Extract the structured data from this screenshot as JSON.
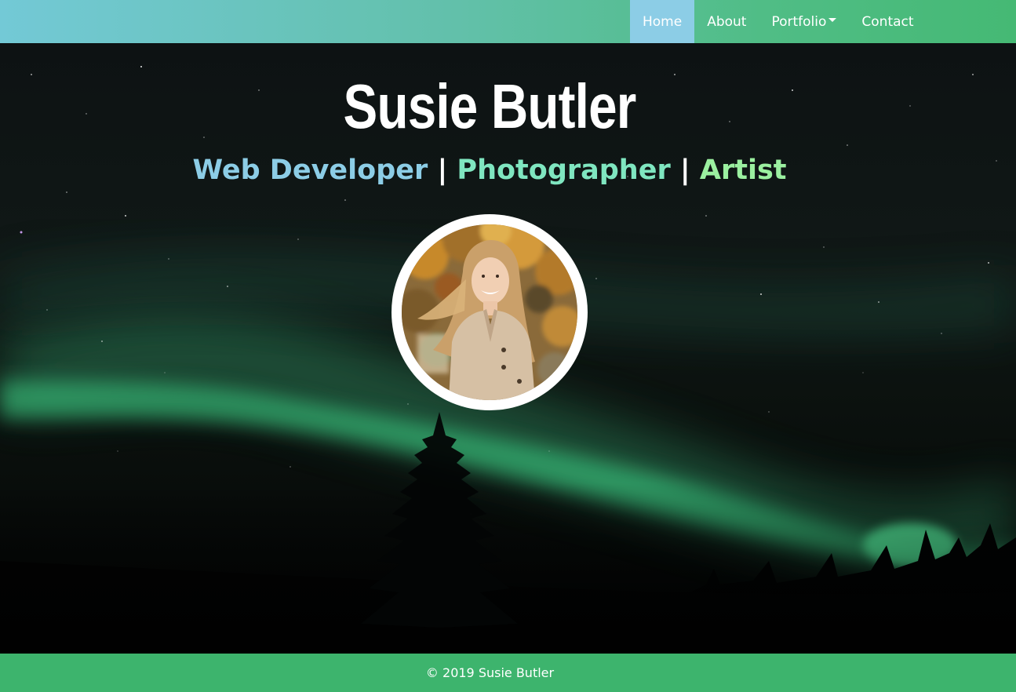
{
  "nav": {
    "items": [
      {
        "label": "Home",
        "active": true
      },
      {
        "label": "About",
        "active": false
      },
      {
        "label": "Portfolio",
        "active": false,
        "dropdown": true
      },
      {
        "label": "Contact",
        "active": false
      }
    ]
  },
  "hero": {
    "name": "Susie Butler",
    "roles": {
      "first": "Web Developer",
      "second": "Photographer",
      "third": "Artist",
      "separator": "|"
    }
  },
  "footer": {
    "text": "© 2019 Susie Butler"
  },
  "colors": {
    "nav_gradient_start": "#73c9d6",
    "nav_gradient_end": "#45b974",
    "nav_active": "#8ccde6",
    "role_web_developer": "#8ccde6",
    "role_photographer": "#7fe6c0",
    "role_artist": "#9bf0a0",
    "footer_bg": "#3db46d",
    "aurora": "#3fdc8c"
  },
  "icons": {
    "portfolio_dropdown": "caret-down-icon"
  }
}
